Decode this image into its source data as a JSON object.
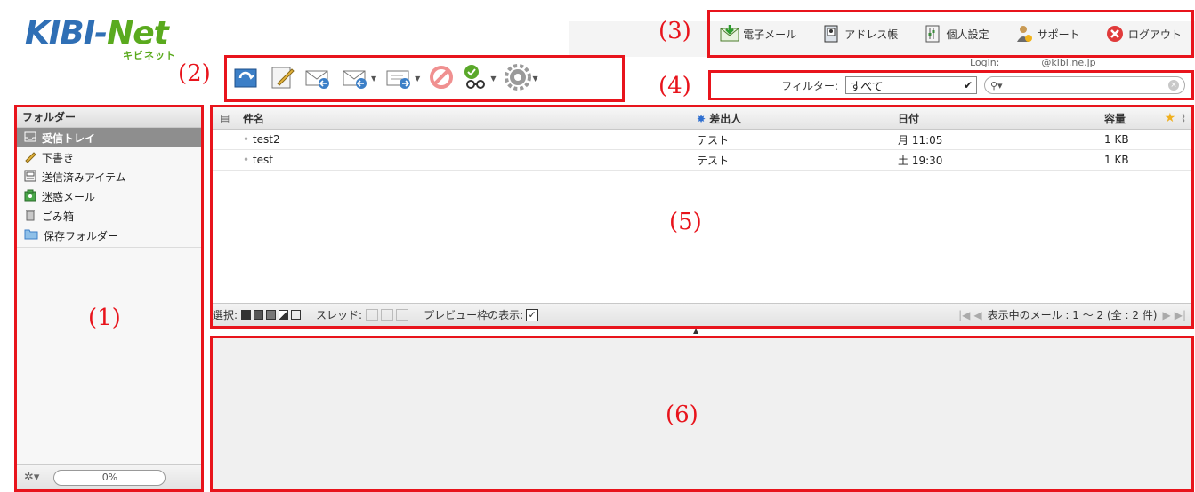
{
  "logo": {
    "part1": "KIBI-",
    "part2": "Net",
    "kana": "キビネット"
  },
  "annotations": {
    "a1": "(1)",
    "a2": "(2)",
    "a3": "(3)",
    "a4": "(4)",
    "a5": "(5)",
    "a6": "(6)"
  },
  "topnav": {
    "items": [
      {
        "label": "電子メール",
        "icon": "mail-download-icon"
      },
      {
        "label": "アドレス帳",
        "icon": "address-book-icon"
      },
      {
        "label": "個人設定",
        "icon": "settings-sheet-icon"
      },
      {
        "label": "サポート",
        "icon": "support-person-icon"
      },
      {
        "label": "ログアウト",
        "icon": "logout-icon"
      }
    ]
  },
  "login": {
    "label": "Login:",
    "user": "@kibi.ne.jp"
  },
  "toolbar": {
    "buttons": [
      "refresh-icon",
      "compose-icon",
      "reply-icon",
      "reply-all-icon",
      "forward-icon",
      "delete-icon",
      "mark-icon",
      "more-gear-icon"
    ]
  },
  "filter": {
    "label": "フィルター:",
    "selected": "すべて",
    "search_placeholder": ""
  },
  "folders": {
    "title": "フォルダー",
    "items": [
      {
        "label": "受信トレイ",
        "icon": "inbox-icon",
        "selected": true
      },
      {
        "label": "下書き",
        "icon": "pencil-icon",
        "selected": false
      },
      {
        "label": "送信済みアイテム",
        "icon": "sent-icon",
        "selected": false
      },
      {
        "label": "迷惑メール",
        "icon": "junk-icon",
        "selected": false
      },
      {
        "label": "ごみ箱",
        "icon": "trash-icon",
        "selected": false
      },
      {
        "label": "保存フォルダー",
        "icon": "folder-icon",
        "selected": false
      }
    ],
    "quota": "0%"
  },
  "messages": {
    "columns": {
      "subject": "件名",
      "from": "差出人",
      "date": "日付",
      "size": "容量"
    },
    "rows": [
      {
        "subject": "test2",
        "from": "テスト",
        "date": "月 11:05",
        "size": "1 KB"
      },
      {
        "subject": "test",
        "from": "テスト",
        "date": "土 19:30",
        "size": "1 KB"
      }
    ],
    "footer": {
      "select_label": "選択:",
      "thread_label": "スレッド:",
      "preview_label": "プレビュー枠の表示:",
      "preview_checked": true,
      "count_text": "表示中のメール : 1 ～ 2 (全 : 2 件)"
    }
  },
  "colors": {
    "annotation_red": "#e8141c",
    "selected_folder": "#8e8e8e",
    "logo_blue": "#2f6fb5",
    "logo_green": "#5aaa1e"
  }
}
